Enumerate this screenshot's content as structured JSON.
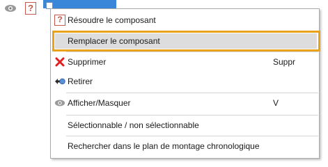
{
  "menu": {
    "items": [
      {
        "label": "Résoudre le composant",
        "shortcut": "",
        "icon": "question-icon"
      },
      {
        "label": "Remplacer le composant",
        "shortcut": "",
        "icon": ""
      },
      {
        "label": "Supprimer",
        "shortcut": "Suppr",
        "icon": "red-x-icon"
      },
      {
        "label": "Retirer",
        "shortcut": "",
        "icon": "arrow-circle-icon"
      },
      {
        "label": "Afficher/Masquer",
        "shortcut": "V",
        "icon": "eye-icon"
      },
      {
        "label": "Sélectionnable / non sélectionnable",
        "shortcut": "",
        "icon": ""
      },
      {
        "label": "Rechercher dans le plan de montage chronologique",
        "shortcut": "",
        "icon": ""
      }
    ],
    "highlighted_item": "Remplacer le composant"
  },
  "colors": {
    "highlight_frame": "#e9a21a",
    "highlight_fill": "#dddddd",
    "selection_blue": "#3a86d8",
    "delete_red": "#e02020"
  }
}
